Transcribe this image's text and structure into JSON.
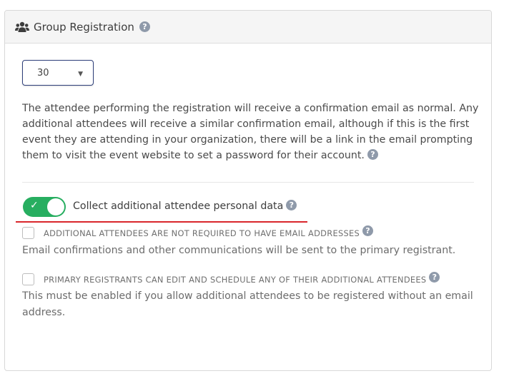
{
  "panel": {
    "title": "Group Registration",
    "header_help": "?"
  },
  "group_size_select": {
    "value": "30",
    "caret": "▼"
  },
  "description": {
    "text": "The attendee performing the registration will receive a confirmation email as normal. Any additional attendees will receive a similar confirmation email, although if this is the first event they are attending in your organization, there will be a link in the email prompting them to visit the event website to set a password for their account.",
    "help": "?"
  },
  "collect_data_toggle": {
    "enabled": true,
    "check_glyph": "✓",
    "label": "Collect additional attendee personal data",
    "help": "?"
  },
  "options": [
    {
      "checked": false,
      "label": "ADDITIONAL ATTENDEES ARE NOT REQUIRED TO HAVE EMAIL ADDRESSES",
      "help": "?",
      "description": "Email confirmations and other communications will be sent to the primary registrant."
    },
    {
      "checked": false,
      "label": "PRIMARY REGISTRANTS CAN EDIT AND SCHEDULE ANY OF THEIR ADDITIONAL ATTENDEES",
      "help": "?",
      "description": "This must be enabled if you allow additional attendees to be registered without an email address."
    }
  ],
  "colors": {
    "toggle_on": "#27ae60",
    "select_border": "#2e3f7a",
    "help_badge": "#8f9aaa",
    "highlight_underline": "#d9262b"
  }
}
